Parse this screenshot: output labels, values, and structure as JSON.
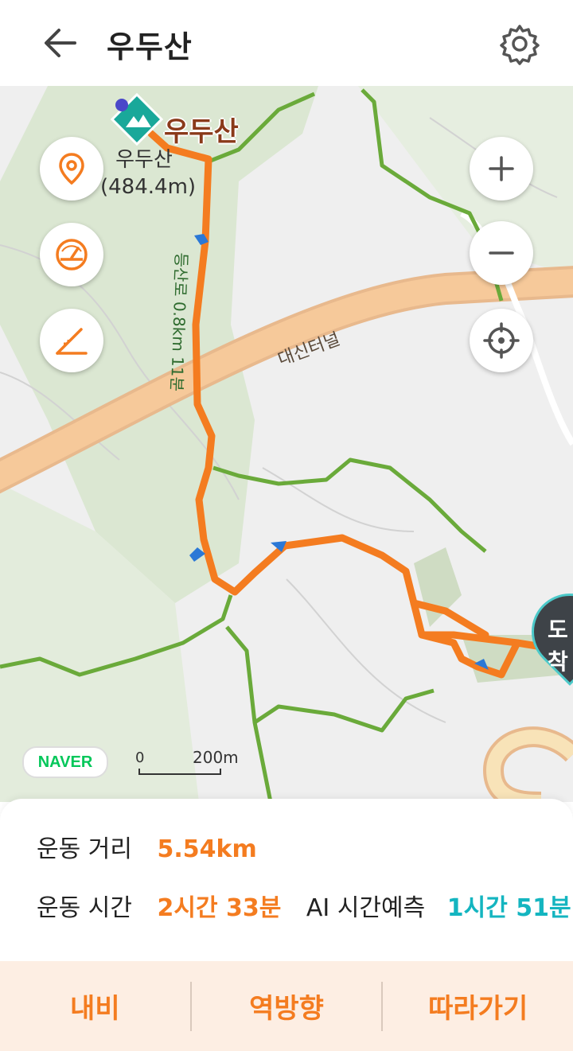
{
  "header": {
    "title": "우두산",
    "back_icon": "arrow-left-icon",
    "settings_icon": "gear-icon"
  },
  "map": {
    "peak_name": "우두산",
    "peak_label_line1": "우두산",
    "peak_label_line2": "(484.4m)",
    "tunnel_label": "대신터널",
    "trail_label": "등산로 0.8km 11분",
    "naver_label": "NAVER",
    "scale_zero": "0",
    "scale_value": "200m",
    "destination_label": "도착",
    "buttons": {
      "location": "location-pin-icon",
      "speed": "speedometer-icon",
      "slope": "slope-icon",
      "zoom_in": "plus-icon",
      "zoom_out": "minus-icon",
      "gps": "crosshair-icon"
    },
    "colors": {
      "route": "#f47c20",
      "trail": "#6aaa3a",
      "road": "#f6c99a",
      "forest": "#d8e6cf"
    }
  },
  "stats": {
    "distance_label": "운동 거리",
    "distance_value": "5.54km",
    "time_label": "운동 시간",
    "time_value": "2시간 33분",
    "ai_label": "AI 시간예측",
    "ai_value": "1시간 51분"
  },
  "actions": {
    "navi": "내비",
    "reverse": "역방향",
    "follow": "따라가기"
  }
}
